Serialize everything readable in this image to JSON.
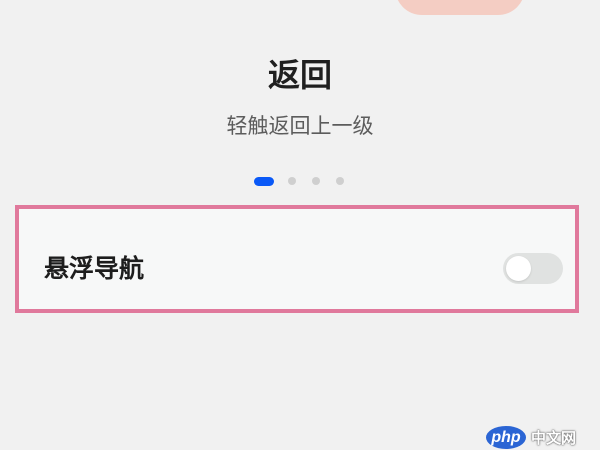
{
  "guide": {
    "title": "返回",
    "subtitle": "轻触返回上一级",
    "page_indicator": {
      "total": 4,
      "current": 1
    }
  },
  "setting": {
    "label": "悬浮导航",
    "toggle_on": false
  },
  "watermark": {
    "logo": "php",
    "text": "中文网"
  },
  "colors": {
    "accent": "#0a59f7",
    "highlight_border": "#e0799c",
    "background": "#f1f1f1",
    "toggle_off": "#e0e2e1"
  }
}
